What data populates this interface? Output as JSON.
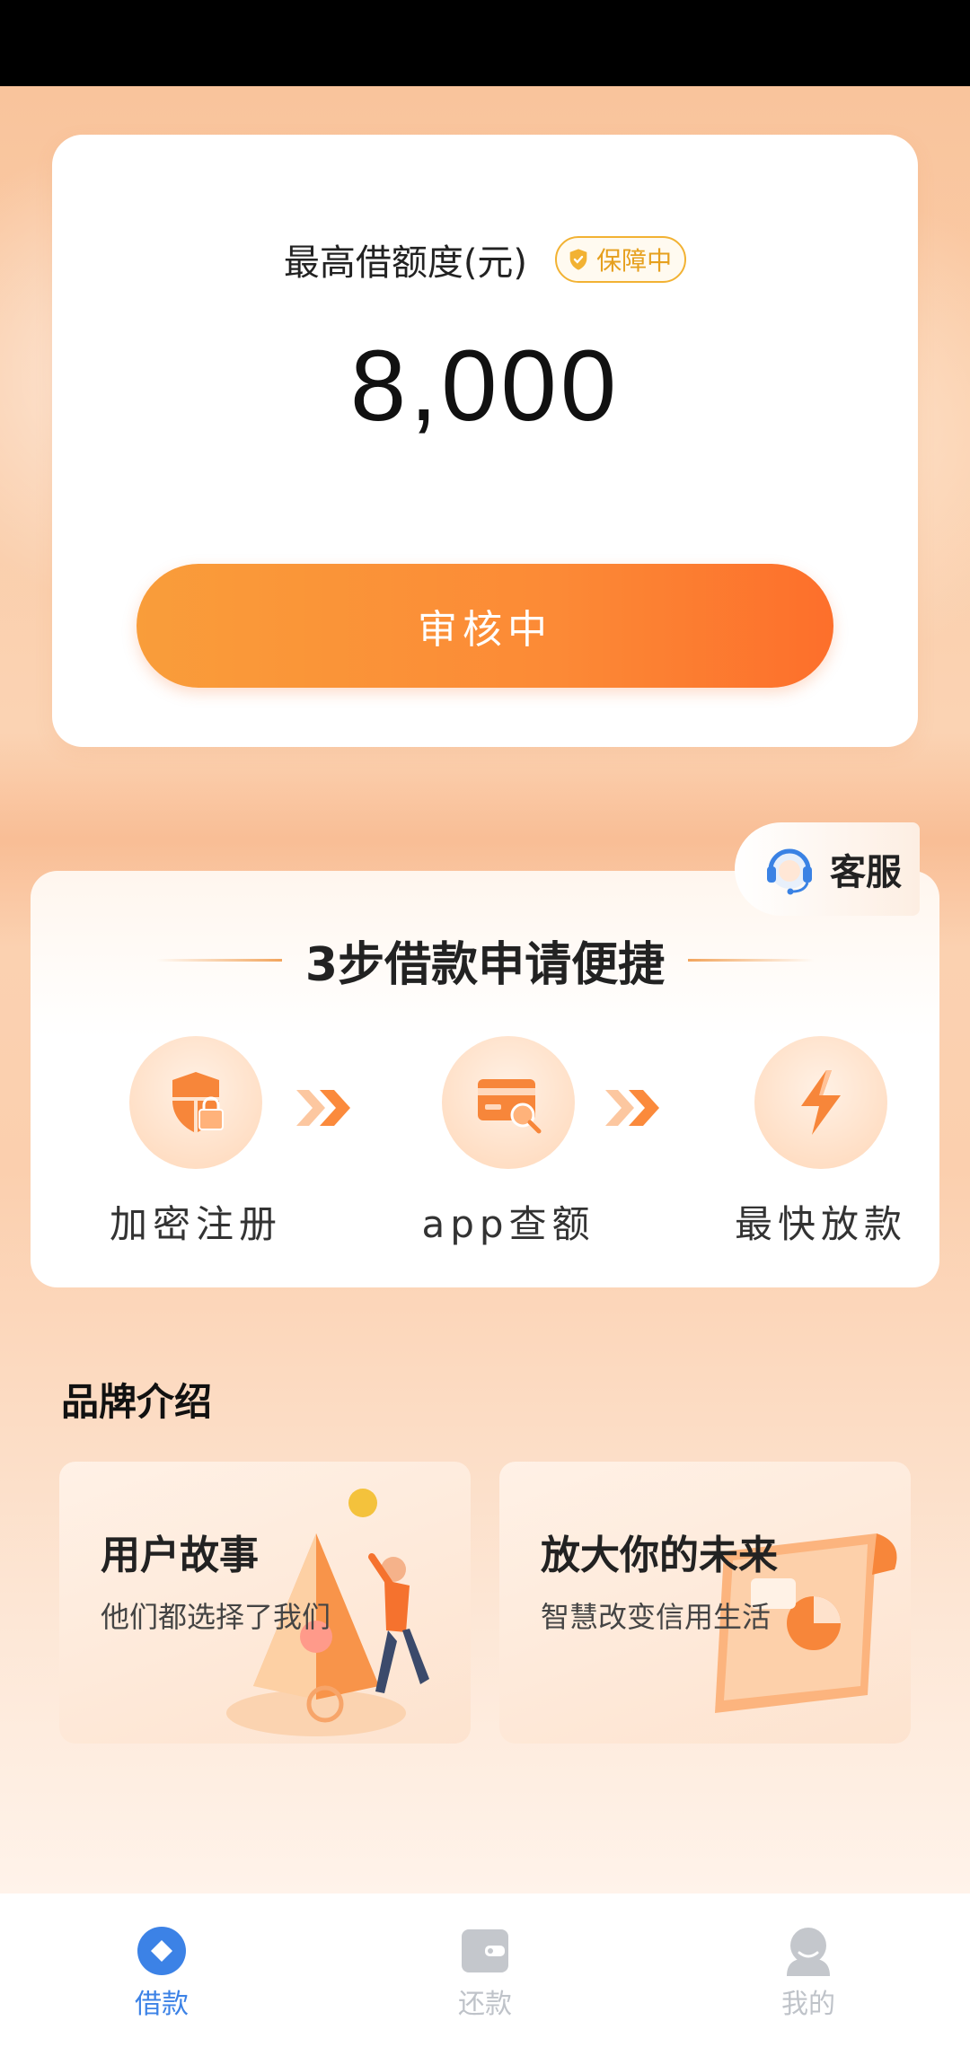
{
  "quota": {
    "label": "最高借额度(元)",
    "badge": "保障中",
    "amount": "8,000",
    "button": "审核中"
  },
  "steps": {
    "customer_service": "客服",
    "title": "3步借款申请便捷",
    "items": [
      {
        "label": "加密注册",
        "icon": "shield-lock-icon"
      },
      {
        "label": "app查额",
        "icon": "card-search-icon"
      },
      {
        "label": "最快放款",
        "icon": "lightning-icon"
      }
    ]
  },
  "brand": {
    "heading": "品牌介绍",
    "cards": [
      {
        "title": "用户故事",
        "subtitle": "他们都选择了我们"
      },
      {
        "title": "放大你的未来",
        "subtitle": "智慧改变信用生活"
      }
    ]
  },
  "nav": {
    "items": [
      {
        "label": "借款",
        "icon": "borrow-icon",
        "active": true
      },
      {
        "label": "还款",
        "icon": "wallet-icon",
        "active": false
      },
      {
        "label": "我的",
        "icon": "user-icon",
        "active": false
      }
    ]
  },
  "colors": {
    "accent": "#fd7a30",
    "nav_active": "#3c82e6",
    "nav_inactive": "#bfc3c9",
    "badge": "#f2b233"
  }
}
